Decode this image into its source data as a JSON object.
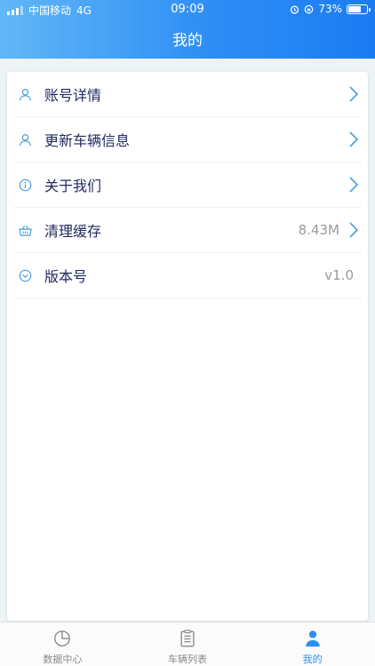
{
  "status_bar": {
    "carrier": "中国移动",
    "network": "4G",
    "time": "09:09",
    "battery": "73%",
    "battery_level": 0.73
  },
  "header": {
    "title": "我的"
  },
  "menu": [
    {
      "label": "账号详情",
      "value": "",
      "icon": "user-icon",
      "has_arrow": true
    },
    {
      "label": "更新车辆信息",
      "value": "",
      "icon": "user-icon",
      "has_arrow": true
    },
    {
      "label": "关于我们",
      "value": "",
      "icon": "info-icon",
      "has_arrow": true
    },
    {
      "label": "清理缓存",
      "value": "8.43M",
      "icon": "basket-icon",
      "has_arrow": true
    },
    {
      "label": "版本号",
      "value": "v1.0",
      "icon": "chevron-circle-icon",
      "has_arrow": false
    }
  ],
  "tabs": [
    {
      "label": "数据中心",
      "icon": "pie-chart-icon",
      "active": false
    },
    {
      "label": "车辆列表",
      "icon": "clipboard-list-icon",
      "active": false
    },
    {
      "label": "我的",
      "icon": "person-icon",
      "active": true
    }
  ],
  "colors": {
    "accent": "#2f8ef5",
    "icon": "#4a9fd8",
    "label": "#222a60"
  }
}
